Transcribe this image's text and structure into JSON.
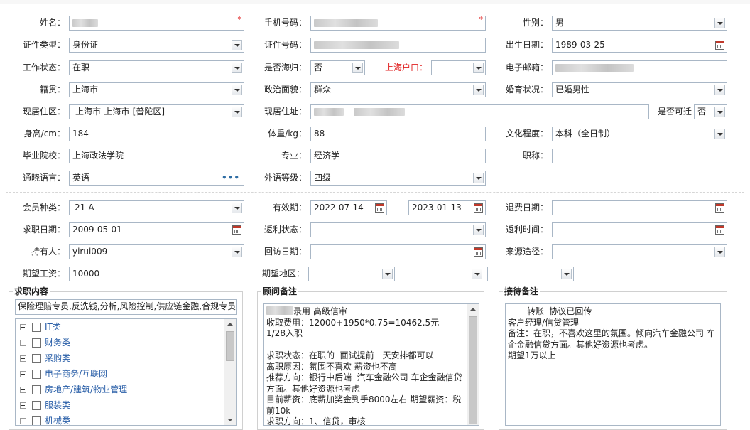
{
  "personal": {
    "name_label": "姓名：",
    "phone_label": "手机号码：",
    "gender_label": "性别：",
    "gender_value": "男",
    "id_type_label": "证件类型：",
    "id_type_value": "身份证",
    "id_number_label": "证件号码：",
    "birth_label": "出生日期：",
    "birth_value": "1989-03-25",
    "work_status_label": "工作状态：",
    "work_status_value": "在职",
    "returnee_label": "是否海归：",
    "returnee_value": "否",
    "shanghai_hukou_label": "上海户口：",
    "email_label": "电子邮箱：",
    "native_label": "籍贯：",
    "native_value": "上海市",
    "political_label": "政治面貌：",
    "political_value": "群众",
    "marital_label": "婚育状况：",
    "marital_value": "已婚男性",
    "residence_label": "现居住区：",
    "residence_value": "上海市-上海市-[普陀区]",
    "address_label": "现居住址：",
    "relocate_label": "是否可迁",
    "relocate_value": "否",
    "height_label": "身高/cm：",
    "height_value": "184",
    "weight_label": "体重/kg：",
    "weight_value": "88",
    "education_label": "文化程度：",
    "education_value": "本科（全日制）",
    "school_label": "毕业院校：",
    "school_value": "上海政法学院",
    "major_label": "专业：",
    "major_value": "经济学",
    "title_label": "职称：",
    "language_label": "通晓语言：",
    "language_value": "英语",
    "lang_level_label": "外语等级：",
    "lang_level_value": "四级"
  },
  "membership": {
    "member_type_label": "会员种类：",
    "member_type_value": "21-A",
    "validity_label": "有效期：",
    "validity_start": "2022-07-14",
    "validity_sep": "----",
    "validity_end": "2023-01-13",
    "refund_date_label": "退费日期：",
    "job_date_label": "求职日期：",
    "job_date_value": "2009-05-01",
    "rebate_status_label": "返利状态：",
    "rebate_time_label": "返利时间：",
    "holder_label": "持有人：",
    "holder_value": "yirui009",
    "revisit_label": "回访日期：",
    "source_label": "来源途径：",
    "salary_label": "期望工资：",
    "salary_value": "10000",
    "region_label": "期望地区："
  },
  "job_content": {
    "title": "求职内容",
    "summary": "保险理赔专员,反洗钱,分析,风险控制,供应链金融,合规专员",
    "categories": [
      "IT类",
      "财务类",
      "采购类",
      "电子商务/互联网",
      "房地产/建筑/物业管理",
      "服装类",
      "机械类"
    ]
  },
  "consultant_notes": {
    "title": "顾问备注",
    "text": "录用 高级信审\n收取费用：12000+1950*0.75=10462.5元\n1/28入职\n\n求职状态：在职的  面试提前一天安排都可以\n离职原因：氛围不喜欢 薪资也不高\n推荐方向：银行中后端  汽车金融公司 车企金融信贷方面。其他好资源也考虑\n目前薪资：底薪加奖金到手8000左右 期望薪资：税前10k\n求职方向：1、信贷，审核"
  },
  "reception_notes": {
    "title": "接待备注",
    "text": "       转账  协议已回传\n客户经理/信贷管理\n备注：在职，不喜欢这里的氛围。倾向汽车金融公司 车企金融信贷方面。其他好资源也考虑。\n期望1万以上"
  },
  "colors": {
    "required": "#e02020",
    "field_border": "#a9b7c6",
    "accent_link": "#2a5fa8"
  }
}
